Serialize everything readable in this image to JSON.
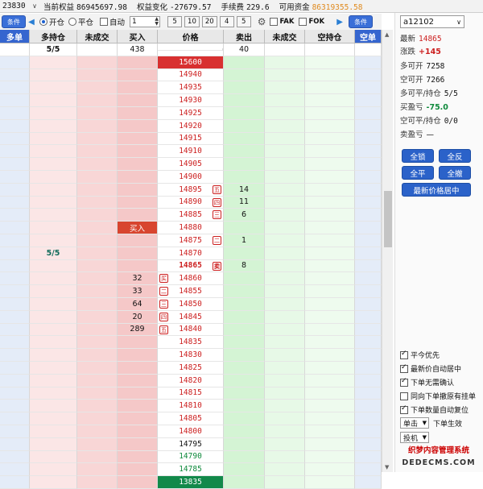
{
  "topbar": {
    "account": "23830",
    "pairs": [
      {
        "label": "当前权益",
        "value": "86945697.98",
        "color": "dark"
      },
      {
        "label": "权益变化",
        "value": "-27679.57",
        "color": "dark"
      },
      {
        "label": "手续费",
        "value": "229.6",
        "color": "dark"
      },
      {
        "label": "可用资金",
        "value": "86319355.58",
        "color": "orange"
      }
    ]
  },
  "toolbar": {
    "left_btn": "条件",
    "right_btn": "条件",
    "open_label": "开仓",
    "close_label": "平仓",
    "auto_label": "自动",
    "qty_value": "1",
    "quick_qty": [
      "5",
      "10",
      "20",
      "4",
      "5"
    ],
    "fak_label": "FAK",
    "fok_label": "FOK"
  },
  "grid": {
    "headers": [
      "多单",
      "多持仓",
      "未成交",
      "买入",
      "价格",
      "卖出",
      "未成交",
      "空持仓",
      "空单"
    ],
    "summary": {
      "long_pos": "5/5",
      "buy": "438",
      "sell": "40"
    },
    "rows": [
      {
        "price": "15600",
        "style": "red-fill",
        "kind": "top"
      },
      {
        "price": "14940",
        "style": "red"
      },
      {
        "price": "14935",
        "style": "red"
      },
      {
        "price": "14930",
        "style": "red"
      },
      {
        "price": "14925",
        "style": "red"
      },
      {
        "price": "14920",
        "style": "red"
      },
      {
        "price": "14915",
        "style": "red"
      },
      {
        "price": "14910",
        "style": "red"
      },
      {
        "price": "14905",
        "style": "red"
      },
      {
        "price": "14900",
        "style": "red"
      },
      {
        "price": "14895",
        "style": "red",
        "tag": "五",
        "sell": "14"
      },
      {
        "price": "14890",
        "style": "red",
        "tag": "四",
        "sell": "11"
      },
      {
        "price": "14885",
        "style": "red",
        "tag": "三",
        "sell": "6"
      },
      {
        "price": "14880",
        "style": "red",
        "buy": "买入",
        "buyfill": true
      },
      {
        "price": "14875",
        "style": "red",
        "tag": "二",
        "sell": "1"
      },
      {
        "price": "14870",
        "style": "red",
        "longpos": "5/5"
      },
      {
        "price": "14865",
        "style": "red-bold",
        "tag": "卖",
        "sell": "8"
      },
      {
        "price": "14860",
        "style": "red",
        "ltag": "买",
        "buy": "32"
      },
      {
        "price": "14855",
        "style": "red",
        "ltag": "二",
        "buy": "33"
      },
      {
        "price": "14850",
        "style": "red",
        "ltag": "三",
        "buy": "64"
      },
      {
        "price": "14845",
        "style": "red",
        "ltag": "四",
        "buy": "20"
      },
      {
        "price": "14840",
        "style": "red",
        "ltag": "五",
        "buy": "289"
      },
      {
        "price": "14835",
        "style": "red"
      },
      {
        "price": "14830",
        "style": "red"
      },
      {
        "price": "14825",
        "style": "red"
      },
      {
        "price": "14820",
        "style": "red"
      },
      {
        "price": "14815",
        "style": "red"
      },
      {
        "price": "14810",
        "style": "red"
      },
      {
        "price": "14805",
        "style": "red"
      },
      {
        "price": "14800",
        "style": "red"
      },
      {
        "price": "14795",
        "style": "black"
      },
      {
        "price": "14790",
        "style": "green"
      },
      {
        "price": "14785",
        "style": "green"
      },
      {
        "price": "13835",
        "style": "green-fill"
      }
    ]
  },
  "panel": {
    "symbol": "a12102",
    "latest_label": "最新",
    "latest_value": "14865",
    "change_label": "涨跌",
    "change_value": "+145",
    "long_open_label": "多可开",
    "long_open_value": "7258",
    "short_open_label": "空可开",
    "short_open_value": "7266",
    "long_close_label": "多可平/持仓",
    "long_close_value": "5/5",
    "buy_pnl_label": "买盈亏",
    "buy_pnl_value": "-75.0",
    "short_close_label": "空可平/持仓",
    "short_close_value": "0/0",
    "sell_pnl_label": "卖盈亏",
    "sell_pnl_value": "—",
    "btn_lock": "全锁",
    "btn_reverse": "全反",
    "btn_flat": "全平",
    "btn_cancel": "全撤",
    "btn_center": "最新价格居中",
    "options": [
      {
        "label": "平今优先",
        "checked": true
      },
      {
        "label": "最新价自动居中",
        "checked": true
      },
      {
        "label": "下单无需确认",
        "checked": true
      },
      {
        "label": "同向下单撤原有挂单",
        "checked": false
      },
      {
        "label": "下单数量自动复位",
        "checked": true
      }
    ],
    "click_mode": "单击",
    "click_mode_label": "下单生效",
    "order_type": "投机",
    "watermark1": "织梦内容管理系统",
    "watermark2": "DEDECMS.COM"
  }
}
